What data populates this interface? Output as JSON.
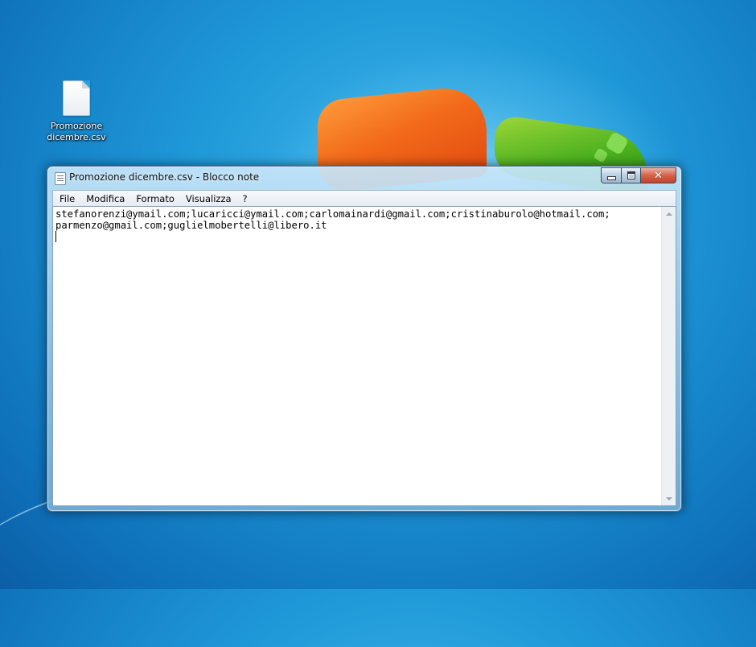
{
  "desktop": {
    "icons": [
      {
        "label_line1": "Promozione",
        "label_line2": "dicembre.csv",
        "icon": "document-icon"
      }
    ]
  },
  "window": {
    "title": "Promozione dicembre.csv - Blocco note",
    "menu": [
      "File",
      "Modifica",
      "Formato",
      "Visualizza",
      "?"
    ],
    "content_lines": [
      "stefanorenzi@ymail.com;lucaricci@ymail.com;carlomainardi@gmail.com;cristinaburolo@hotmail.com;",
      "parmenzo@gmail.com;guglielmobertelli@libero.it"
    ]
  }
}
